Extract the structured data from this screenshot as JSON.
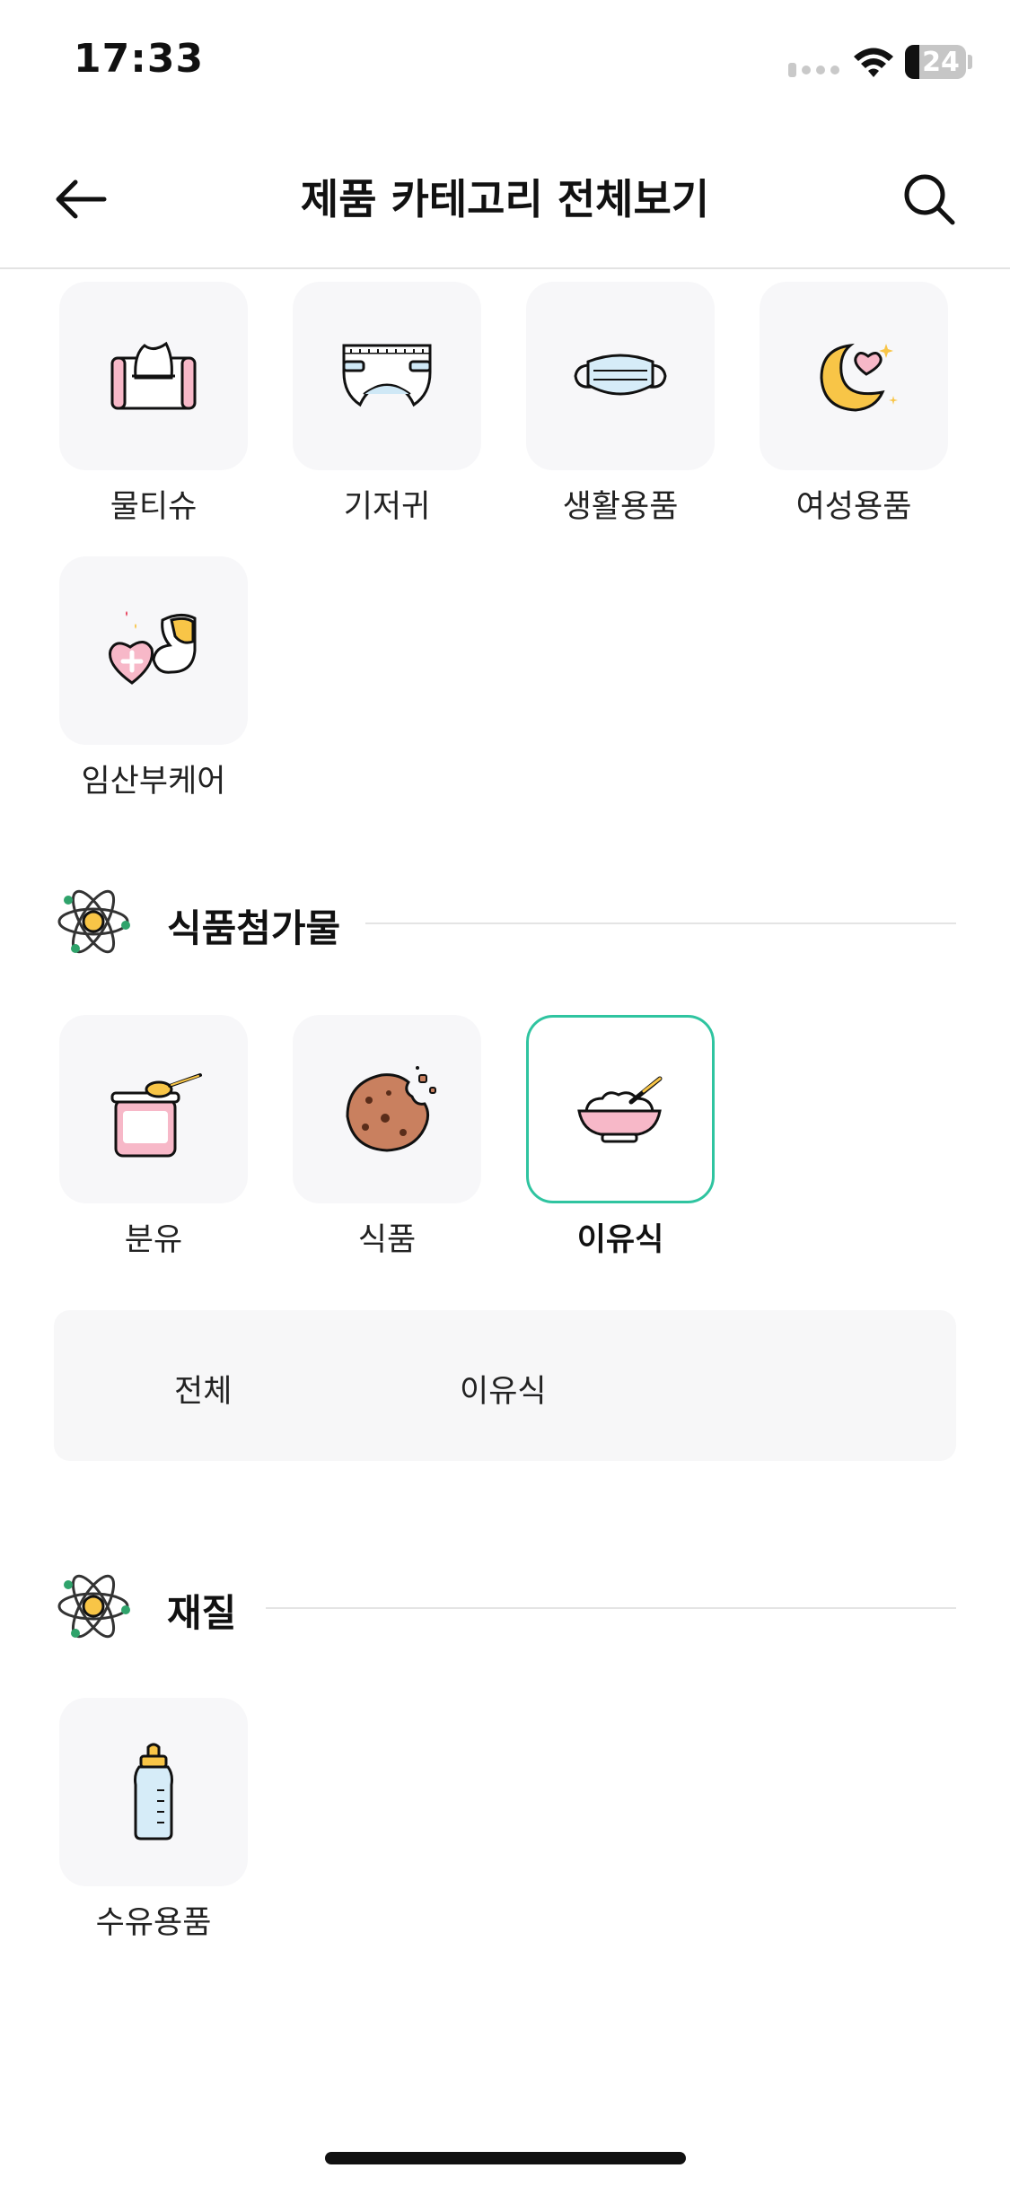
{
  "status": {
    "time": "17:33",
    "battery": "24"
  },
  "nav": {
    "title": "제품 카테고리 전체보기",
    "back_icon": "arrow-left-icon",
    "search_icon": "search-icon"
  },
  "top_categories": [
    {
      "label": "물티슈",
      "icon": "wet-wipes-icon"
    },
    {
      "label": "기저귀",
      "icon": "diaper-icon"
    },
    {
      "label": "생활용품",
      "icon": "mask-icon"
    },
    {
      "label": "여성용품",
      "icon": "moon-heart-icon"
    },
    {
      "label": "임산부케어",
      "icon": "pregnancy-care-icon"
    }
  ],
  "food_section": {
    "title": "식품첨가물",
    "icon": "atom-icon",
    "items": [
      {
        "label": "분유",
        "icon": "formula-icon"
      },
      {
        "label": "식품",
        "icon": "cookie-icon"
      },
      {
        "label": "이유식",
        "icon": "baby-food-bowl-icon",
        "selected": true
      }
    ],
    "sub_options": [
      "전체",
      "이유식"
    ]
  },
  "material_section": {
    "title": "재질",
    "icon": "atom-icon",
    "items": [
      {
        "label": "수유용품",
        "icon": "baby-bottle-icon"
      }
    ]
  },
  "colors": {
    "accent": "#2fc4a0",
    "tile_bg": "#f7f7f9",
    "pink": "#f7b8c8",
    "yellow": "#f8c547"
  }
}
